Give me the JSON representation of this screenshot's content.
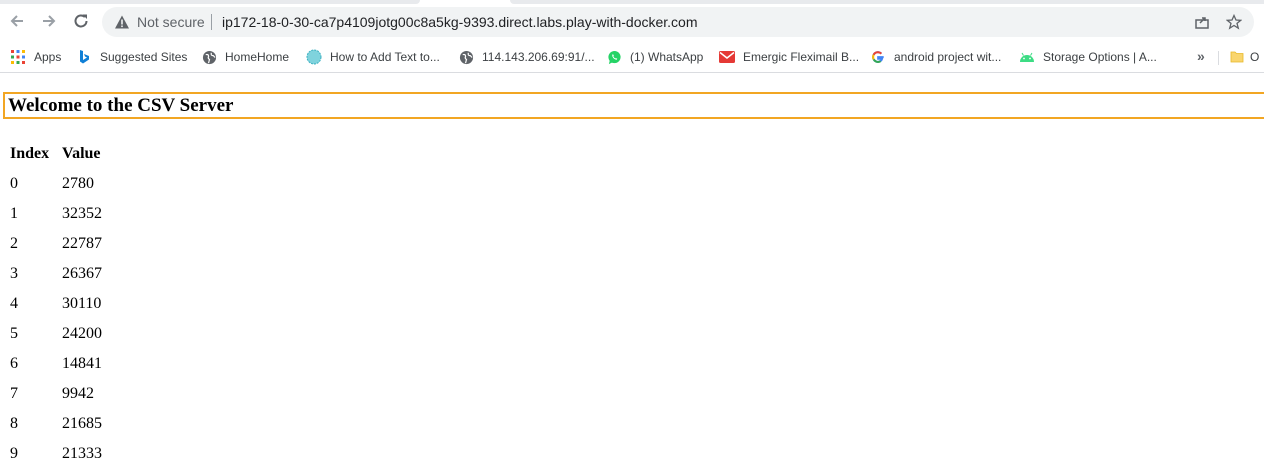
{
  "browser": {
    "security_text": "Not secure",
    "url": "ip172-18-0-30-ca7p4109jotg00c8a5kg-9393.direct.labs.play-with-docker.com"
  },
  "bookmarks": [
    {
      "label": "Apps",
      "icon": "apps-grid-icon"
    },
    {
      "label": "Suggested Sites",
      "icon": "bing-icon"
    },
    {
      "label": "HomeHome",
      "icon": "globe-icon"
    },
    {
      "label": "How to Add Text to...",
      "icon": "teal-circle-icon"
    },
    {
      "label": "114.143.206.69:91/...",
      "icon": "globe-icon"
    },
    {
      "label": "(1) WhatsApp",
      "icon": "whatsapp-icon"
    },
    {
      "label": "Emergic Fleximail B...",
      "icon": "mail-icon"
    },
    {
      "label": "android project wit...",
      "icon": "google-icon"
    },
    {
      "label": "Storage Options | A...",
      "icon": "android-icon"
    }
  ],
  "bookmarks_overflow": "»",
  "other_bookmarks_label": "O",
  "page": {
    "heading": "Welcome to the CSV Server",
    "table": {
      "headers": [
        "Index",
        "Value"
      ],
      "rows": [
        [
          "0",
          "2780"
        ],
        [
          "1",
          "32352"
        ],
        [
          "2",
          "22787"
        ],
        [
          "3",
          "26367"
        ],
        [
          "4",
          "30110"
        ],
        [
          "5",
          "24200"
        ],
        [
          "6",
          "14841"
        ],
        [
          "7",
          "9942"
        ],
        [
          "8",
          "21685"
        ],
        [
          "9",
          "21333"
        ]
      ]
    }
  },
  "colors": {
    "heading_border": "#f2a623",
    "omnibox_bg": "#f1f3f4"
  }
}
